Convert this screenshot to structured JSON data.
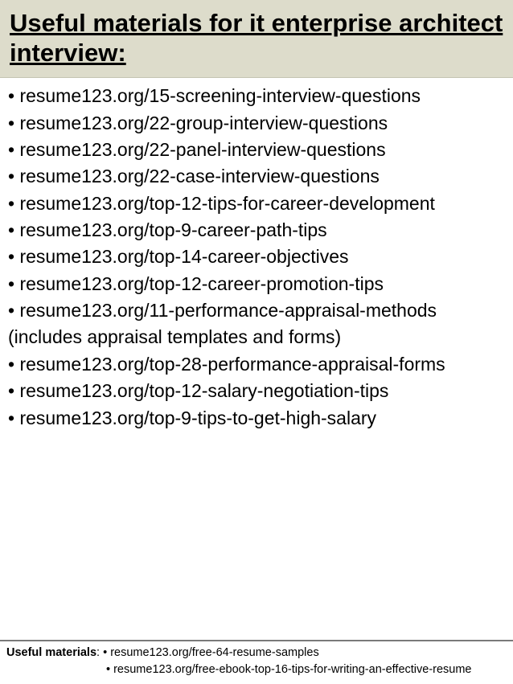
{
  "header": {
    "title": "Useful materials for it enterprise architect interview:"
  },
  "items": [
    "• resume123.org/15-screening-interview-questions",
    "• resume123.org/22-group-interview-questions",
    "• resume123.org/22-panel-interview-questions",
    "• resume123.org/22-case-interview-questions",
    "• resume123.org/top-12-tips-for-career-development",
    "• resume123.org/top-9-career-path-tips",
    "• resume123.org/top-14-career-objectives",
    "• resume123.org/top-12-career-promotion-tips",
    "• resume123.org/11-performance-appraisal-methods (includes appraisal templates and forms)",
    "• resume123.org/top-28-performance-appraisal-forms",
    "• resume123.org/top-12-salary-negotiation-tips",
    "• resume123.org/top-9-tips-to-get-high-salary"
  ],
  "footer": {
    "label": "Useful materials",
    "line1": ": • resume123.org/free-64-resume-samples",
    "line2": "• resume123.org/free-ebook-top-16-tips-for-writing-an-effective-resume"
  }
}
